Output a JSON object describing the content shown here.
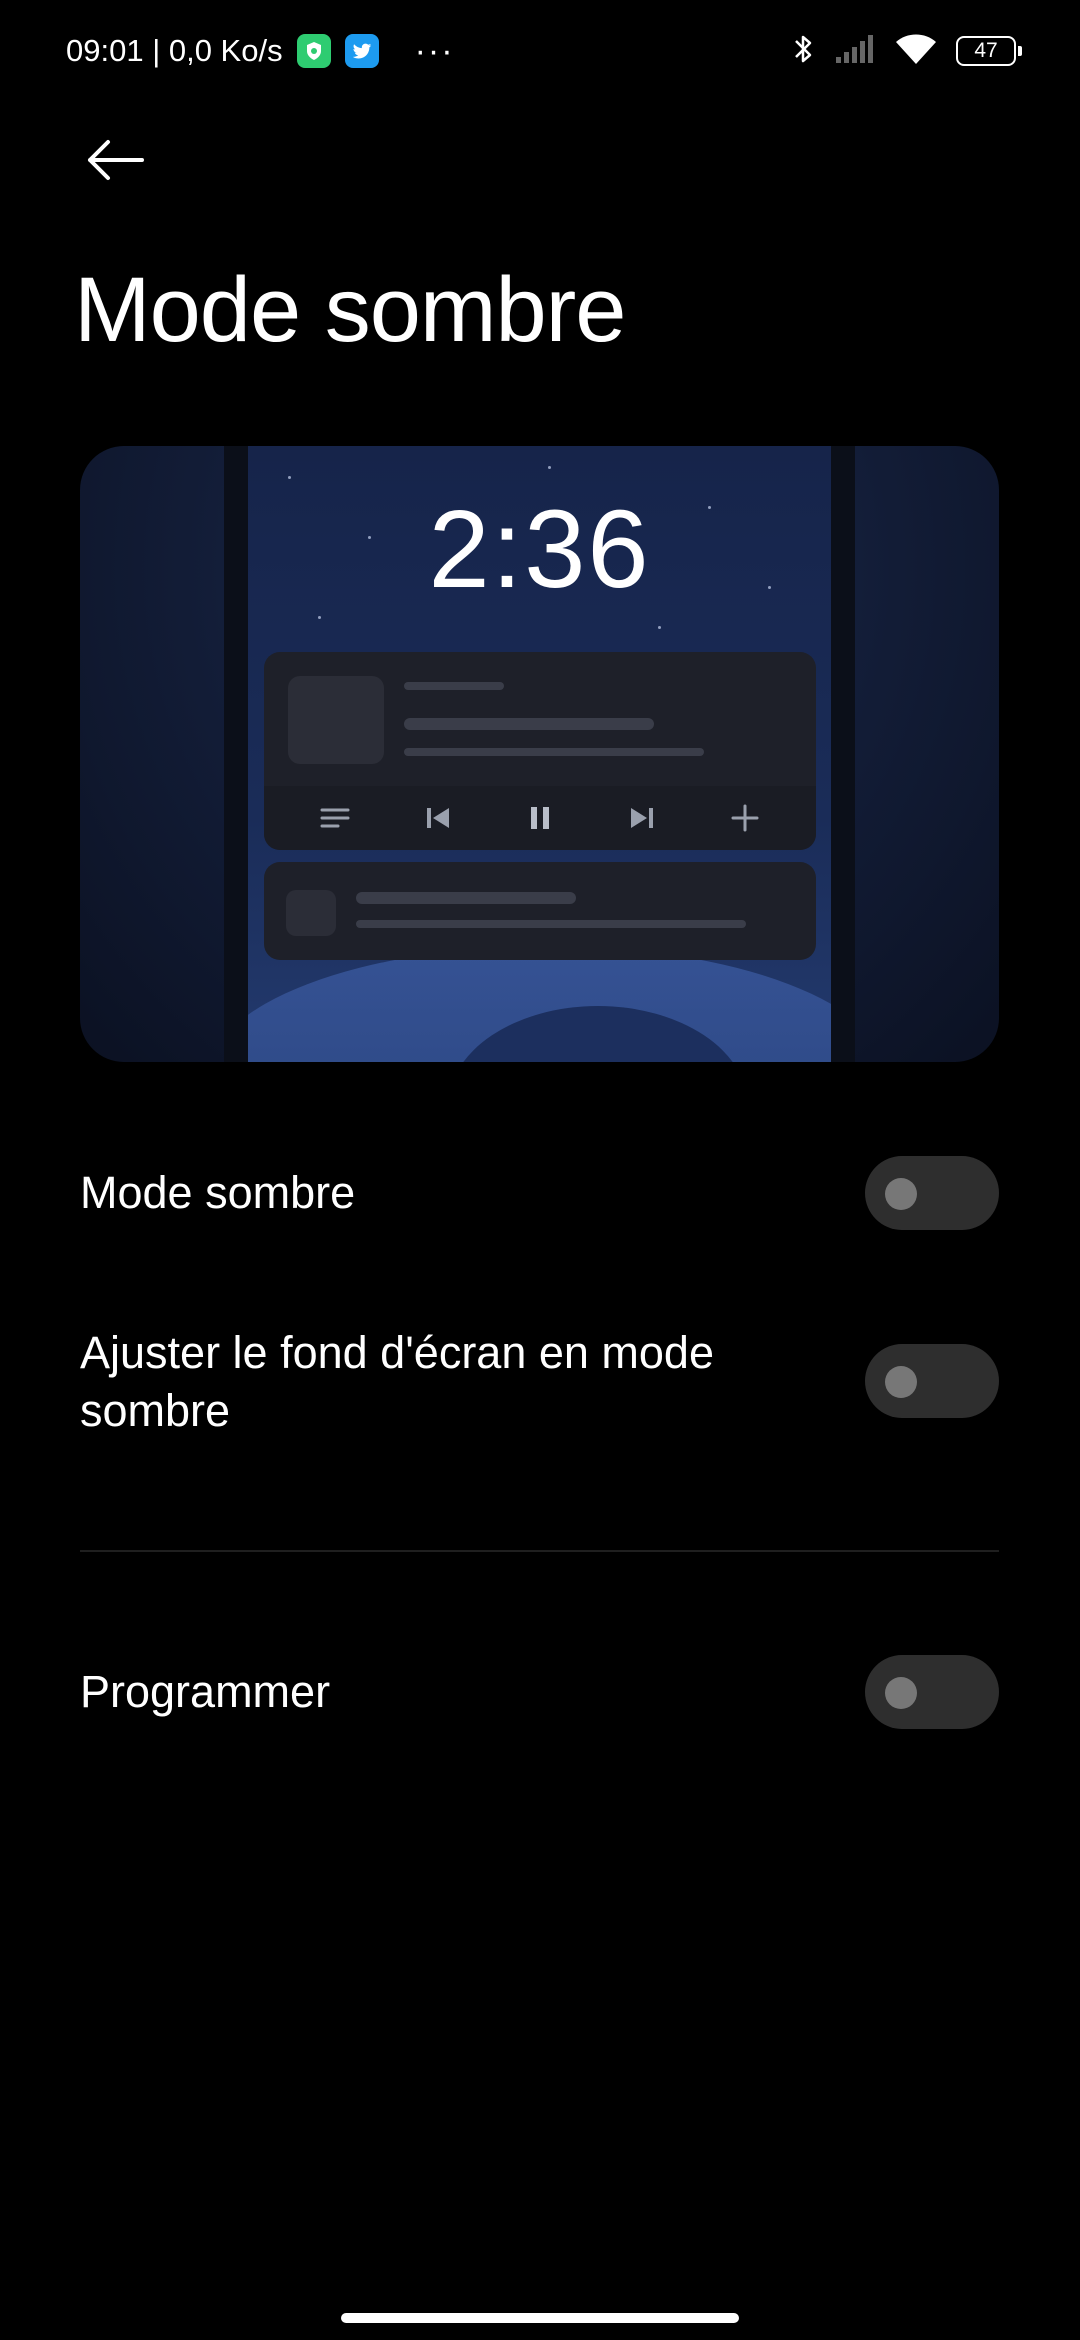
{
  "status_bar": {
    "time_speed": "09:01 | 0,0 Ko/s",
    "more_indicator": "···",
    "battery_level": "47",
    "icons": [
      "shield-app-icon",
      "twitter-icon",
      "bluetooth-icon",
      "signal-icon",
      "wifi-icon",
      "battery-icon"
    ]
  },
  "header": {
    "back_icon": "arrow-left-icon",
    "title": "Mode sombre"
  },
  "preview": {
    "lock_time": "2:36",
    "media_controls": [
      "playlist-icon",
      "previous-icon",
      "pause-icon",
      "next-icon",
      "add-icon"
    ]
  },
  "settings": {
    "dark_mode": {
      "label": "Mode sombre",
      "enabled": false
    },
    "adjust_wallpaper": {
      "label": "Ajuster le fond d'écran en mode sombre",
      "enabled": false
    },
    "schedule": {
      "label": "Programmer",
      "enabled": false
    }
  },
  "colors": {
    "background": "#000000",
    "toggle_off_track": "#2e2e2e",
    "toggle_off_knob": "#777777",
    "divider": "#1f1f1f"
  }
}
